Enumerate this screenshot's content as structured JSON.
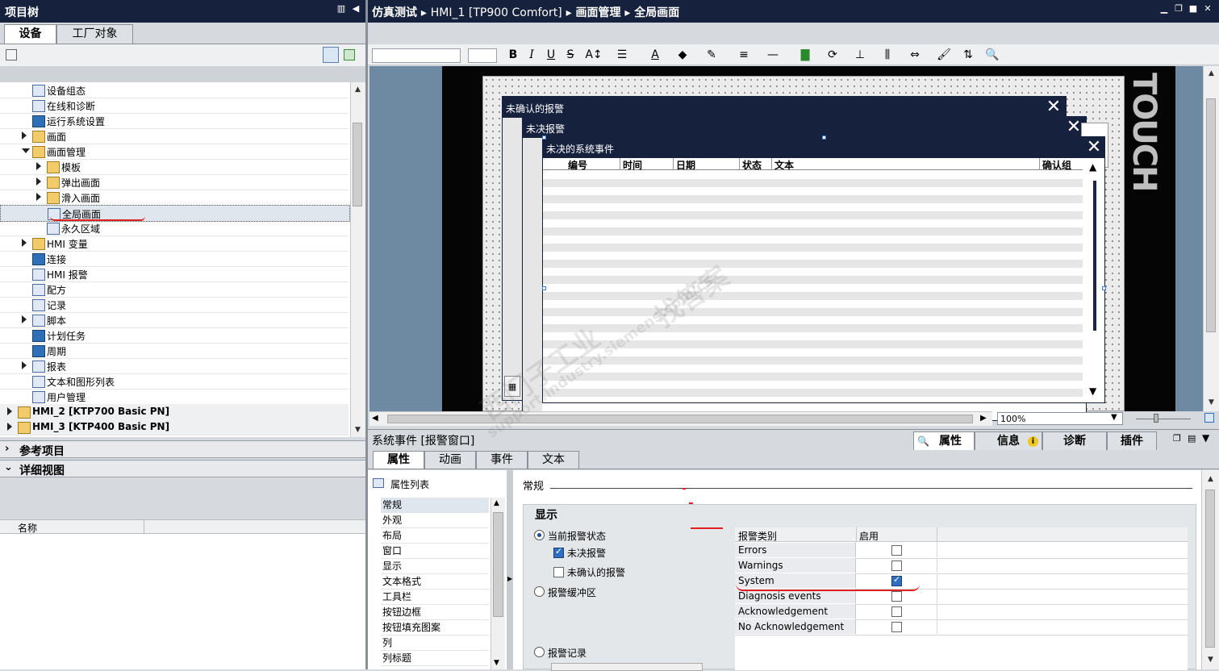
{
  "project_tree": {
    "title": "项目树",
    "tabs": [
      "设备",
      "工厂对象"
    ],
    "items": [
      {
        "label": "设备组态",
        "level": 2,
        "expand": "",
        "icon": "gen"
      },
      {
        "label": "在线和诊断",
        "level": 2,
        "expand": "",
        "icon": "gen"
      },
      {
        "label": "运行系统设置",
        "level": 2,
        "expand": "",
        "icon": "blue"
      },
      {
        "label": "画面",
        "level": 2,
        "expand": "r",
        "icon": "folder"
      },
      {
        "label": "画面管理",
        "level": 2,
        "expand": "d",
        "icon": "folder"
      },
      {
        "label": "模板",
        "level": 3,
        "expand": "r",
        "icon": "folder"
      },
      {
        "label": "弹出画面",
        "level": 3,
        "expand": "r",
        "icon": "folder"
      },
      {
        "label": "滑入画面",
        "level": 3,
        "expand": "r",
        "icon": "folder"
      },
      {
        "label": "全局画面",
        "level": 3,
        "expand": "",
        "icon": "gen",
        "selected": true
      },
      {
        "label": "永久区域",
        "level": 3,
        "expand": "",
        "icon": "gen"
      },
      {
        "label": "HMI 变量",
        "level": 2,
        "expand": "r",
        "icon": "folder"
      },
      {
        "label": "连接",
        "level": 2,
        "expand": "",
        "icon": "blue"
      },
      {
        "label": "HMI 报警",
        "level": 2,
        "expand": "",
        "icon": "gen"
      },
      {
        "label": "配方",
        "level": 2,
        "expand": "",
        "icon": "gen"
      },
      {
        "label": "记录",
        "level": 2,
        "expand": "",
        "icon": "gen"
      },
      {
        "label": "脚本",
        "level": 2,
        "expand": "r",
        "icon": "gen"
      },
      {
        "label": "计划任务",
        "level": 2,
        "expand": "",
        "icon": "blue"
      },
      {
        "label": "周期",
        "level": 2,
        "expand": "",
        "icon": "blue"
      },
      {
        "label": "报表",
        "level": 2,
        "expand": "r",
        "icon": "gen"
      },
      {
        "label": "文本和图形列表",
        "level": 2,
        "expand": "",
        "icon": "gen"
      },
      {
        "label": "用户管理",
        "level": 2,
        "expand": "",
        "icon": "gen"
      },
      {
        "label": "HMI_2 [KTP700 Basic PN]",
        "level": 1,
        "expand": "r",
        "icon": "folder",
        "bold": true
      },
      {
        "label": "HMI_3 [KTP400 Basic PN]",
        "level": 1,
        "expand": "r",
        "icon": "folder",
        "bold": true
      }
    ]
  },
  "reference_projects": {
    "title": "参考项目"
  },
  "detail_view": {
    "title": "详细视图",
    "column_name": "名称"
  },
  "editor": {
    "breadcrumb": [
      "仿真测试",
      "HMI_1 [TP900 Comfort]",
      "画面管理",
      "全局画面"
    ],
    "zoom": "100%",
    "touch_label": "TOUCH",
    "windows": [
      {
        "title": "未确认的报警"
      },
      {
        "title": "未决报警"
      },
      {
        "title": "未决的系统事件"
      }
    ],
    "columns": [
      "编号",
      "时间",
      "日期",
      "状态",
      "文本",
      "确认组"
    ]
  },
  "inspector": {
    "title": "系统事件 [报警窗口]",
    "top_tabs": [
      "属性",
      "信息",
      "诊断",
      "插件"
    ],
    "tabs": [
      "属性",
      "动画",
      "事件",
      "文本"
    ],
    "prop_list_label": "属性列表",
    "prop_items": [
      "常规",
      "外观",
      "布局",
      "窗口",
      "显示",
      "文本格式",
      "工具栏",
      "按钮边框",
      "按钮填充图案",
      "列",
      "列标题"
    ],
    "section_label": "常规",
    "group_title": "显示",
    "radio_current": "当前报警状态",
    "chk_pending": "未决报警",
    "chk_unack": "未确认的报警",
    "radio_buffer": "报警缓冲区",
    "radio_log": "报警记录",
    "grid": {
      "headers": [
        "报警类别",
        "启用"
      ],
      "rows": [
        {
          "name": "Errors",
          "enabled": false
        },
        {
          "name": "Warnings",
          "enabled": false
        },
        {
          "name": "System",
          "enabled": true
        },
        {
          "name": "Diagnosis events",
          "enabled": false
        },
        {
          "name": "Acknowledgement",
          "enabled": false
        },
        {
          "name": "No Acknowledgement",
          "enabled": false
        }
      ]
    }
  },
  "watermark": {
    "line1": "西门子工业",
    "line2": "找答案",
    "line3": "support.industry.siemens.com/cs"
  },
  "colors": {
    "title_bg": "#16213d",
    "accent": "#2f6fc1",
    "annotation_red": "#e02020"
  }
}
